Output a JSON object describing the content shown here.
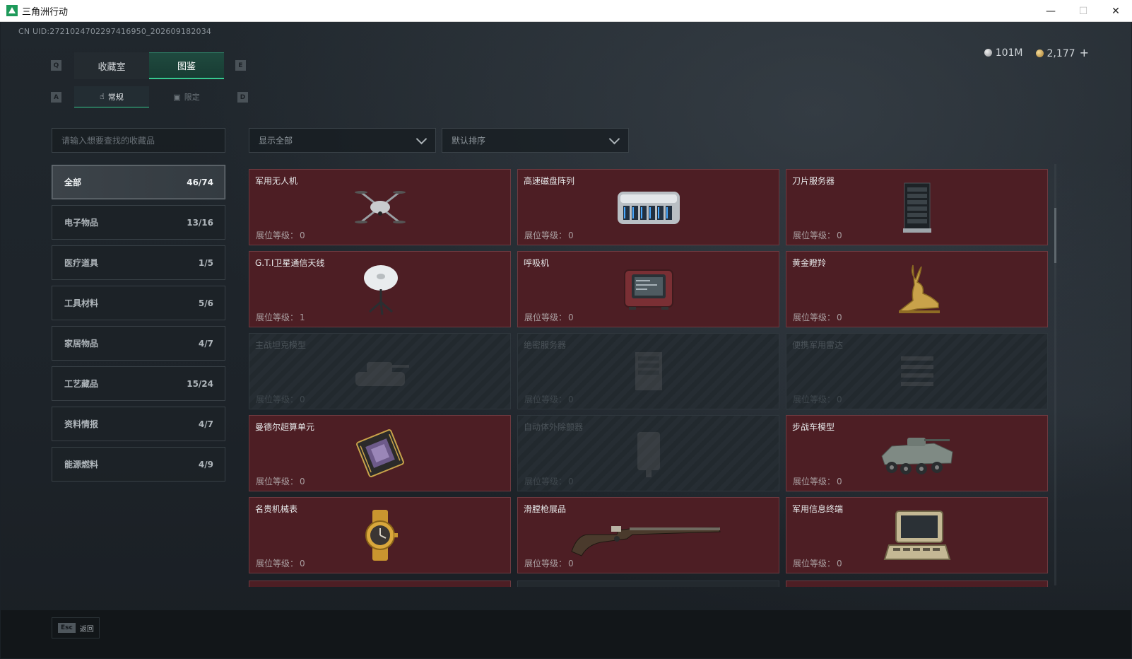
{
  "window": {
    "title": "三角洲行动",
    "minimize": "—",
    "maximize": "☐",
    "close": "✕"
  },
  "uid": "CN UID:2721024702297416950_202609182034",
  "currency": {
    "silver": "101M",
    "gold": "2,177",
    "add": "+"
  },
  "main_tabs": [
    {
      "label": "收藏室",
      "active": false
    },
    {
      "label": "图鉴",
      "active": true
    }
  ],
  "main_tab_keys": {
    "left": "Q",
    "right": "E"
  },
  "sub_tabs": [
    {
      "label": "常规",
      "icon": "hand-icon",
      "active": true
    },
    {
      "label": "限定",
      "icon": "image-icon",
      "active": false
    }
  ],
  "sub_tab_keys": {
    "left": "A",
    "right": "D"
  },
  "search": {
    "placeholder": "请输入想要查找的收藏品",
    "value": ""
  },
  "filter_dropdown": {
    "value": "显示全部"
  },
  "sort_dropdown": {
    "value": "默认排序"
  },
  "categories": [
    {
      "name": "全部",
      "count": "46/74",
      "active": true
    },
    {
      "name": "电子物品",
      "count": "13/16",
      "active": false
    },
    {
      "name": "医疗道具",
      "count": "1/5",
      "active": false
    },
    {
      "name": "工具材料",
      "count": "5/6",
      "active": false
    },
    {
      "name": "家居物品",
      "count": "4/7",
      "active": false
    },
    {
      "name": "工艺藏品",
      "count": "15/24",
      "active": false
    },
    {
      "name": "资料情报",
      "count": "4/7",
      "active": false
    },
    {
      "name": "能源燃料",
      "count": "4/9",
      "active": false
    }
  ],
  "level_label": "展位等级：",
  "items": [
    {
      "name": "军用无人机",
      "level": "0",
      "unlocked": true,
      "icon": "drone-icon"
    },
    {
      "name": "高速磁盘阵列",
      "level": "0",
      "unlocked": true,
      "icon": "disk-array-icon"
    },
    {
      "name": "刀片服务器",
      "level": "0",
      "unlocked": true,
      "icon": "server-icon"
    },
    {
      "name": "G.T.I卫星通信天线",
      "level": "1",
      "unlocked": true,
      "icon": "satellite-dish-icon"
    },
    {
      "name": "呼吸机",
      "level": "0",
      "unlocked": true,
      "icon": "ventilator-icon"
    },
    {
      "name": "黄金瞪羚",
      "level": "0",
      "unlocked": true,
      "icon": "golden-gazelle-icon"
    },
    {
      "name": "主战坦克模型",
      "level": "0",
      "unlocked": false,
      "icon": "tank-icon"
    },
    {
      "name": "绝密服务器",
      "level": "0",
      "unlocked": false,
      "icon": "secret-server-icon"
    },
    {
      "name": "便携军用雷达",
      "level": "0",
      "unlocked": false,
      "icon": "radar-icon"
    },
    {
      "name": "曼德尔超算单元",
      "level": "0",
      "unlocked": true,
      "icon": "cpu-chip-icon"
    },
    {
      "name": "自动体外除颤器",
      "level": "0",
      "unlocked": false,
      "icon": "defibrillator-icon"
    },
    {
      "name": "步战车模型",
      "level": "0",
      "unlocked": true,
      "icon": "ifv-icon"
    },
    {
      "name": "名贵机械表",
      "level": "0",
      "unlocked": true,
      "icon": "watch-icon"
    },
    {
      "name": "滑膛枪展品",
      "level": "0",
      "unlocked": true,
      "icon": "musket-icon"
    },
    {
      "name": "军用信息终端",
      "level": "0",
      "unlocked": true,
      "icon": "terminal-icon"
    }
  ],
  "footer": {
    "esc_key": "Esc",
    "esc_label": "返回"
  }
}
